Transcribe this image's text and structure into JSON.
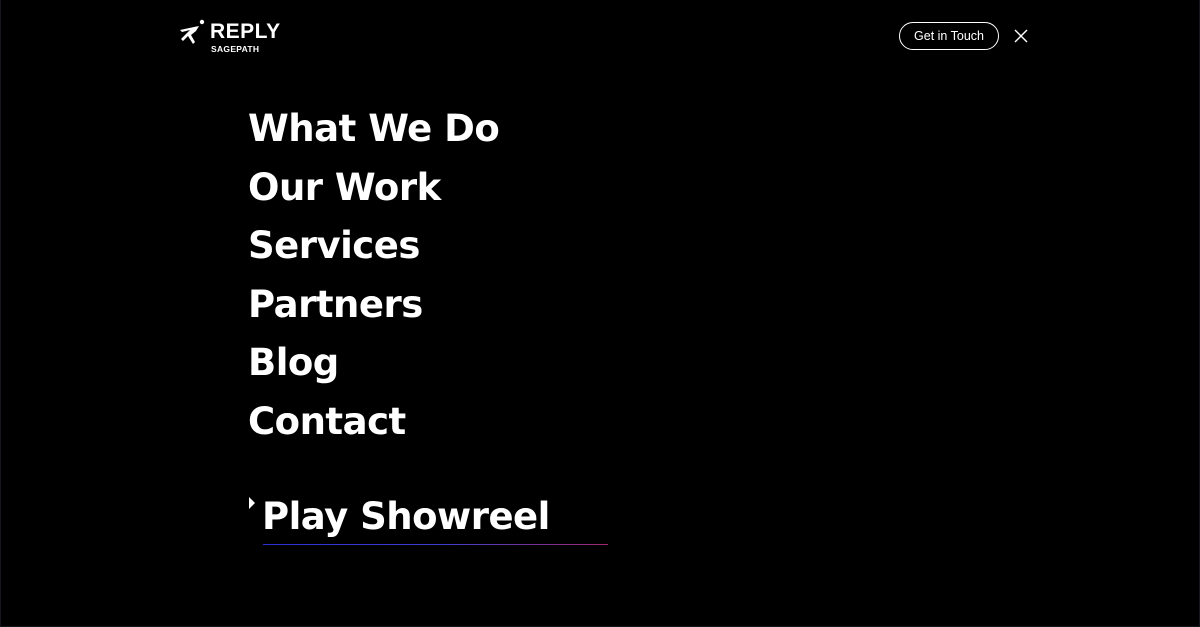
{
  "header": {
    "logo": {
      "brand": "REPLY",
      "sub": "SAGEPATH",
      "icon": "running-figure-icon"
    },
    "cta_label": "Get in Touch",
    "close_icon": "close-icon"
  },
  "nav": {
    "items": [
      {
        "label": "What We Do"
      },
      {
        "label": "Our Work"
      },
      {
        "label": "Services"
      },
      {
        "label": "Partners"
      },
      {
        "label": "Blog"
      },
      {
        "label": "Contact"
      }
    ]
  },
  "showreel": {
    "label": "Play Showreel",
    "icon": "play-icon"
  },
  "colors": {
    "background": "#000000",
    "text": "#ffffff",
    "underline_start": "#2a2fd8",
    "underline_end": "#a0286f"
  }
}
